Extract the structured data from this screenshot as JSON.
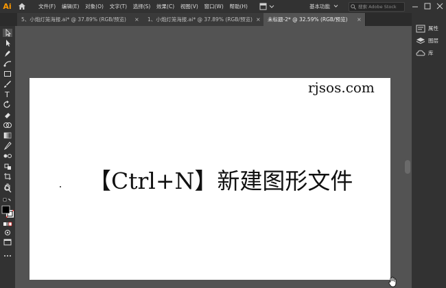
{
  "app": {
    "logo": "Ai",
    "accent": "#ff9a00"
  },
  "menu": {
    "items": [
      "文件(F)",
      "编辑(E)",
      "对象(O)",
      "文字(T)",
      "选择(S)",
      "效果(C)",
      "视图(V)",
      "窗口(W)",
      "帮助(H)"
    ],
    "workspace": "基本功能",
    "search_placeholder": "搜索 Adobe Stock"
  },
  "tabs": [
    {
      "label": "5、小炮灯笼海报.ai* @ 37.89% (RGB/预览)",
      "close": "×"
    },
    {
      "label": "1、小炮灯笼海报.ai* @ 37.89% (RGB/预览)",
      "close": "×"
    },
    {
      "label": "未标题-2* @ 32.59% (RGB/预览)",
      "close": "×"
    }
  ],
  "panels": {
    "properties": "属性",
    "layers": "图层",
    "libraries": "库"
  },
  "canvas": {
    "watermark": "rjsos.com",
    "headline": "【Ctrl+N】新建图形文件"
  }
}
